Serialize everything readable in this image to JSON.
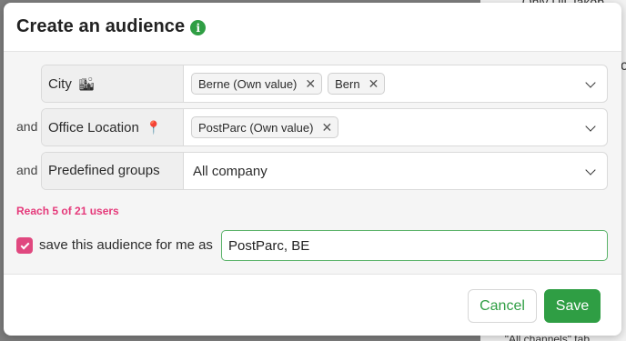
{
  "background": {
    "top_text": "Only Uli Jakob",
    "mid_text": "c",
    "bottom_text": "\"All channels\" tab"
  },
  "modal": {
    "title": "Create an audience",
    "info_icon": "info-icon",
    "rows": [
      {
        "conjunction": "",
        "label": "City",
        "label_emoji": "🏙",
        "chips": [
          "Berne (Own value)",
          "Bern"
        ]
      },
      {
        "conjunction": "and",
        "label": "Office Location",
        "label_emoji": "📍",
        "chips": [
          "PostParc (Own value)"
        ]
      },
      {
        "conjunction": "and",
        "label": "Predefined groups",
        "value": "All company"
      }
    ],
    "reach_text": "Reach 5 of 21 users",
    "save_checkbox_checked": true,
    "save_label": "save this audience for me as",
    "audience_name_value": "PostParc, BE",
    "cancel_label": "Cancel",
    "save_button_label": "Save"
  },
  "colors": {
    "accent_green": "#2f9e44",
    "accent_pink": "#e0487f",
    "reach_pink": "#e5397a"
  }
}
